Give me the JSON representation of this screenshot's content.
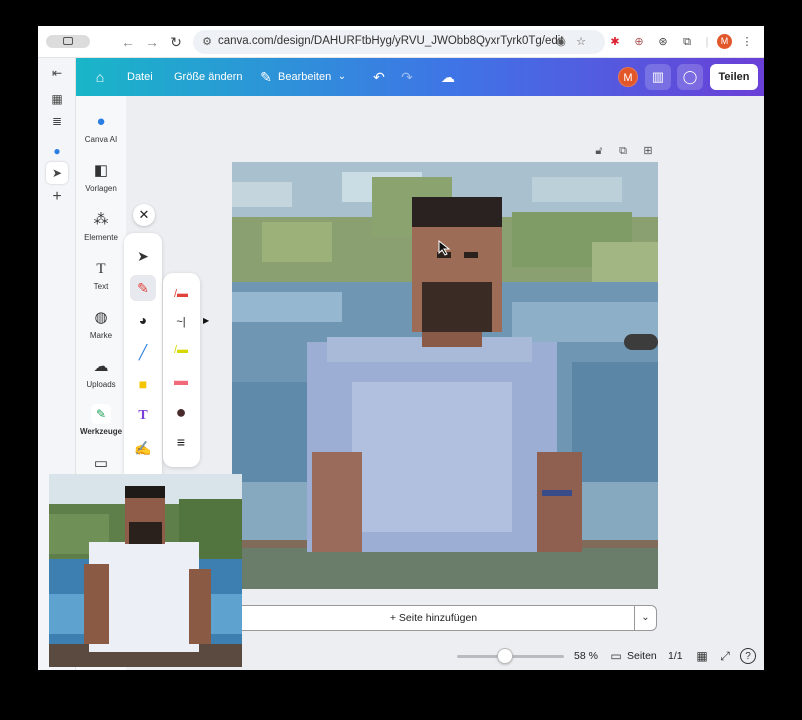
{
  "browser": {
    "url": "canva.com/design/DAHURFtbHyg/yRVU_JWObb8QyxrTyrk0Tg/edit",
    "profile_initial": "M"
  },
  "topbar": {
    "file_label": "Datei",
    "resize_label": "Größe ändern",
    "edit_label": "Bearbeiten",
    "avatar_initial": "M",
    "share_label": "Teilen"
  },
  "sidemenu": {
    "items": [
      {
        "label": "Canva AI",
        "icon": "canva-ai-icon"
      },
      {
        "label": "Vorlagen",
        "icon": "templates-icon"
      },
      {
        "label": "Elemente",
        "icon": "elements-icon"
      },
      {
        "label": "Text",
        "icon": "text-icon"
      },
      {
        "label": "Marke",
        "icon": "brand-icon"
      },
      {
        "label": "Uploads",
        "icon": "uploads-icon"
      },
      {
        "label": "Werkzeuge",
        "icon": "tools-icon"
      }
    ]
  },
  "canvas": {
    "add_page_label": "+ Seite hinzufügen"
  },
  "footer": {
    "zoom_fraction": 0.45,
    "zoom_label": "58 %",
    "pages_label": "Seiten",
    "page_count": "1/1"
  },
  "colors": {
    "topbar_start": "#19b6c8",
    "topbar_end": "#6a3fd8",
    "avatar": "#e2572a",
    "pen_selected": "#e0433a"
  }
}
